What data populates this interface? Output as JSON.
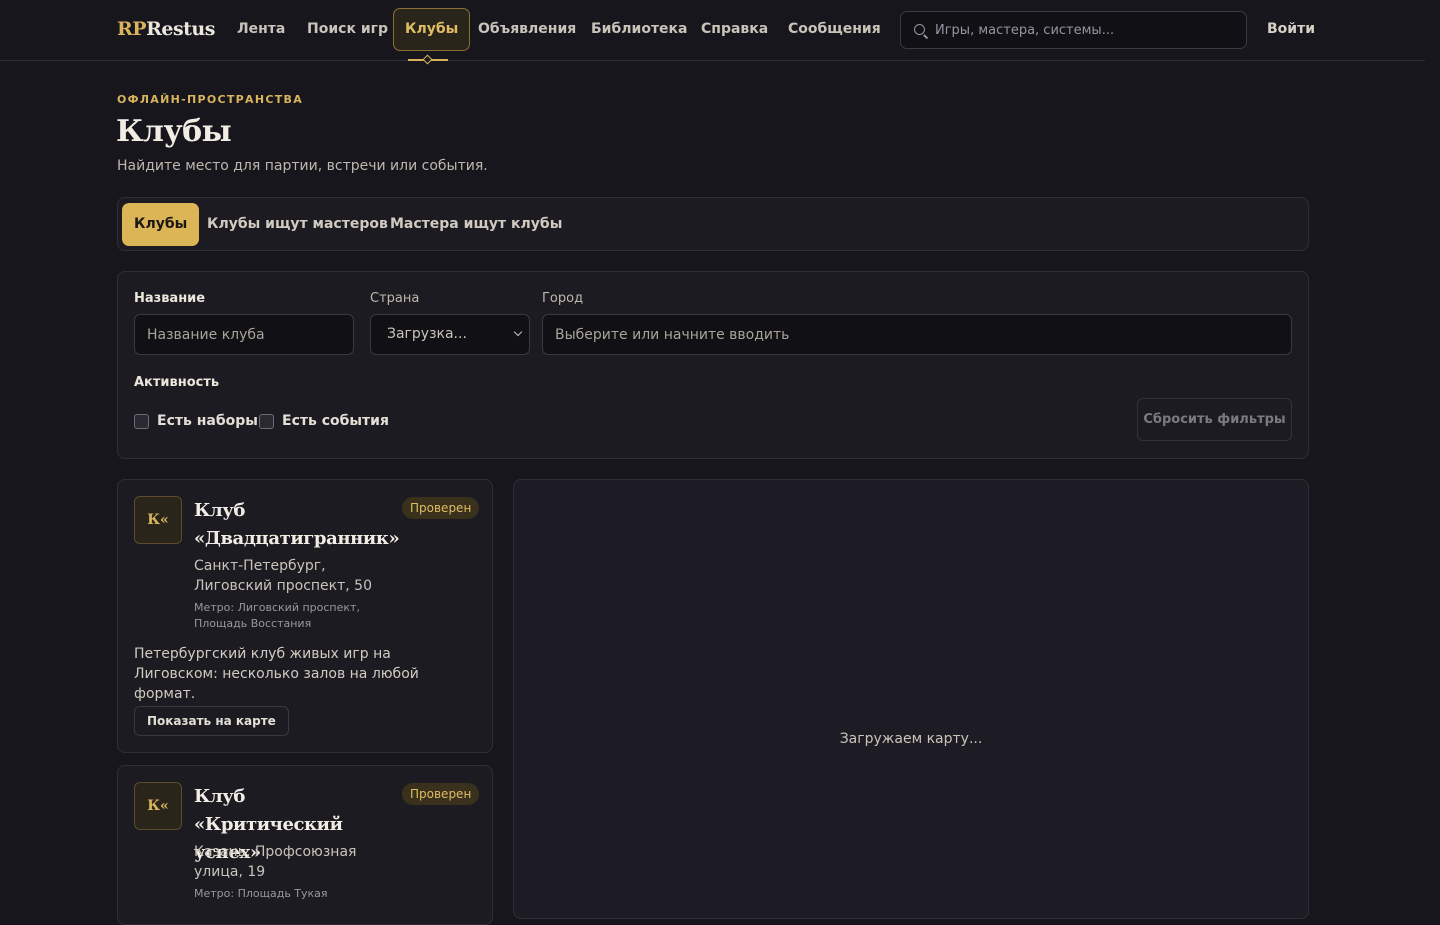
{
  "header": {
    "logo_accent": "RP",
    "logo_rest": "Restus",
    "nav": [
      {
        "label": "Лента"
      },
      {
        "label": "Поиск игр"
      },
      {
        "label": "Клубы"
      },
      {
        "label": "Объявления"
      },
      {
        "label": "Библиотека"
      },
      {
        "label": "Справка"
      },
      {
        "label": "Сообщения"
      }
    ],
    "active_nav": "Клубы",
    "search_placeholder": "Игры, мастера, системы...",
    "login_label": "Войти"
  },
  "page": {
    "eyebrow": "ОФЛАЙН-ПРОСТРАНСТВА",
    "title": "Клубы",
    "subtitle": "Найдите место для партии, встречи или события."
  },
  "tabs": [
    {
      "label": "Клубы"
    },
    {
      "label": "Клубы ищут мастеров"
    },
    {
      "label": "Мастера ищут клубы"
    }
  ],
  "filters": {
    "name_label": "Название",
    "name_placeholder": "Название клуба",
    "country_label": "Страна",
    "country_value": "Загрузка...",
    "city_label": "Город",
    "city_placeholder": "Выберите или начните вводить",
    "activity_label": "Активность",
    "checkboxes": [
      {
        "label": "Есть наборы",
        "checked": false
      },
      {
        "label": "Есть события",
        "checked": false
      }
    ],
    "reset_label": "Сбросить фильтры"
  },
  "clubs": [
    {
      "avatar": "К«",
      "title": "Клуб «Двадцатигранник»",
      "badge": "Проверен",
      "address": "Санкт-Петербург, Лиговский проспект, 50",
      "metro": "Метро: Лиговский проспект, Площадь Восстания",
      "description": "Петербургский клуб живых игр на Лиговском: несколько залов на любой формат.",
      "map_button": "Показать на карте"
    },
    {
      "avatar": "К«",
      "title": "Клуб «Критический успех»",
      "badge": "Проверен",
      "address": "Казань, Профсоюзная улица, 19",
      "metro": "Метро: Площадь Тукая"
    }
  ],
  "map": {
    "loading_text": "Загружаем карту..."
  },
  "colors": {
    "background": "#17161d",
    "accent": "#d9b45c",
    "panel": "#1c1b22"
  }
}
